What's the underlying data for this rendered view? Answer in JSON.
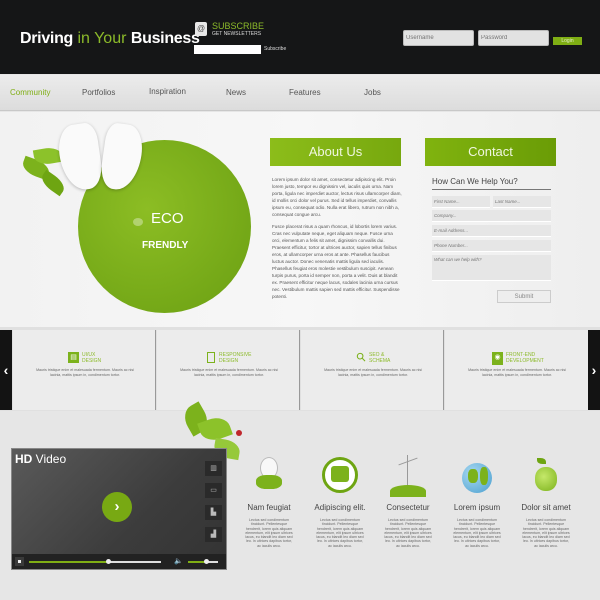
{
  "header": {
    "logo": {
      "part1": "Driving",
      "part2": " in Your ",
      "part3": "Business"
    },
    "newsletter": {
      "title": "SUBSCRIBE",
      "subtitle": "GET NEWSLETTERS",
      "input_value": "",
      "button": "Subscribe",
      "icon": "address-book-icon"
    },
    "login": {
      "username_placeholder": "Username",
      "password_placeholder": "Password",
      "button": "Login"
    }
  },
  "nav": {
    "items": [
      "Community",
      "Portfolios",
      "Inspiration",
      "News",
      "Features",
      "Jobs"
    ],
    "active": "Community"
  },
  "hero": {
    "badge": {
      "line1": "ECO",
      "line2": "FRENDLY"
    },
    "about": {
      "title": "About Us",
      "paragraphs": [
        "Lorem ipsum dolor sit amet, consectetur adipiscing elit. Proin lorem justo, tempor eu dignissim vel, iaculis quis urna. Nam porta, ligula nec imperdiet auctor, lectus risus ullamcorper diam, id mollis orci dolor vel purus. Sed id tellus imperdiet, convallis ipsum eu, consequat odio. Nulla erat libero, rutrum non nibh a, consequat congue arcu.",
        "Fusce placerat risus a quam rhoncus, id lobortis lorem varius. Cras nec vulputate neque, eget aliquam neque. Fusce urna orci, elementum a felis sit amet, dignissim convallis dui. Praesent efficitur, tortor at ultrices auctor, sapien tellus finibus eros, at ullamcorper urna eros at ante. Phasellus faucibus luctus auctor. Donec venenatis mattis ligula sed iaculis. Phasellus feugiat eros molestie vestibulum suscipit. Aenean turpis purus, porta id semper non, porta a velit. Duis at blandit ex. Praesent efficitur neque lacus, sodales lacinia urna cursus nec. Vestibulum mattis sapien sed mattis efficitur. Suspendisse potenti."
      ]
    },
    "contact": {
      "title": "Contact",
      "heading": "How Can We Help You?",
      "fields": {
        "first_name": "First Name...",
        "last_name": "Last Name...",
        "company": "Company...",
        "email": "E-mail Address...",
        "phone": "Phone Number...",
        "message": "What can we help with?"
      },
      "submit": "Submit"
    }
  },
  "features": {
    "prev": "‹",
    "next": "›",
    "items": [
      {
        "title1": "UI/UX",
        "title2": "DESIGN",
        "icon": "layout-icon",
        "glyph": "▤",
        "text": "Mauris tristique enim et malesuada fermentum. Mauris ac nisi lacinia, mattis ipsum in, condimentum tortor."
      },
      {
        "title1": "RESPONSIVE",
        "title2": "DESIGN",
        "icon": "mobile-icon",
        "glyph": "▯",
        "text": "Mauris tristique enim et malesuada fermentum. Mauris ac nisi lacinia, mattis ipsum in, condimentum tortor."
      },
      {
        "title1": "SEO &",
        "title2": "SCHEMA",
        "icon": "search-icon",
        "glyph": "⚲",
        "text": "Mauris tristique enim et malesuada fermentum. Mauris ac nisi lacinia, mattis ipsum in, condimentum tortor."
      },
      {
        "title1": "FRONT-END",
        "title2": "DEVELOPMENT",
        "icon": "code-book-icon",
        "glyph": "◉",
        "text": "Mauris tristique enim et malesuada fermentum. Mauris ac nisi lacinia, mattis ipsum in, condimentum tortor."
      }
    ]
  },
  "video": {
    "title_bold": "HD",
    "title": " Video",
    "progress": 0.6,
    "volume": 0.6,
    "side_buttons": [
      "film-icon",
      "hd-icon",
      "equalizer-icon",
      "signal-icon"
    ]
  },
  "columns": [
    {
      "title": "Nam feugiat",
      "icon": "lightbulb-icon",
      "text": "Lectus sed condimentum tincidunt. Pellentesque hendrerit, lorem quis aliquam elementum, elit ipsum ultrices lacus, eu blandit leo diam sed leo. In ultrices dapibus tortor, ac iaculis arcu."
    },
    {
      "title": "Adipiscing elit.",
      "icon": "thumbs-up-icon",
      "text": "Lectus sed condimentum tincidunt. Pellentesque hendrerit, lorem quis aliquam elementum, elit ipsum ultrices lacus, eu blandit leo diam sed leo. In ultrices dapibus tortor, ac iaculis arcu."
    },
    {
      "title": "Consectetur",
      "icon": "wind-turbine-icon",
      "text": "Lectus sed condimentum tincidunt. Pellentesque hendrerit, lorem quis aliquam elementum, elit ipsum ultrices lacus, eu blandit leo diam sed leo. In ultrices dapibus tortor, ac iaculis arcu."
    },
    {
      "title": "Lorem ipsum",
      "icon": "globe-icon",
      "text": "Lectus sed condimentum tincidunt. Pellentesque hendrerit, lorem quis aliquam elementum, elit ipsum ultrices lacus, eu blandit leo diam sed leo. In ultrices dapibus tortor, ac iaculis arcu."
    },
    {
      "title": "Dolor sit amet",
      "icon": "apple-icon",
      "text": "Lectus sed condimentum tincidunt. Pellentesque hendrerit, lorem quis aliquam elementum, elit ipsum ultrices lacus, eu blandit leo diam sed leo. In ultrices dapibus tortor, ac iaculis arcu."
    }
  ],
  "colors": {
    "accent": "#7fae14",
    "dark": "#151617",
    "light": "#ececec"
  }
}
